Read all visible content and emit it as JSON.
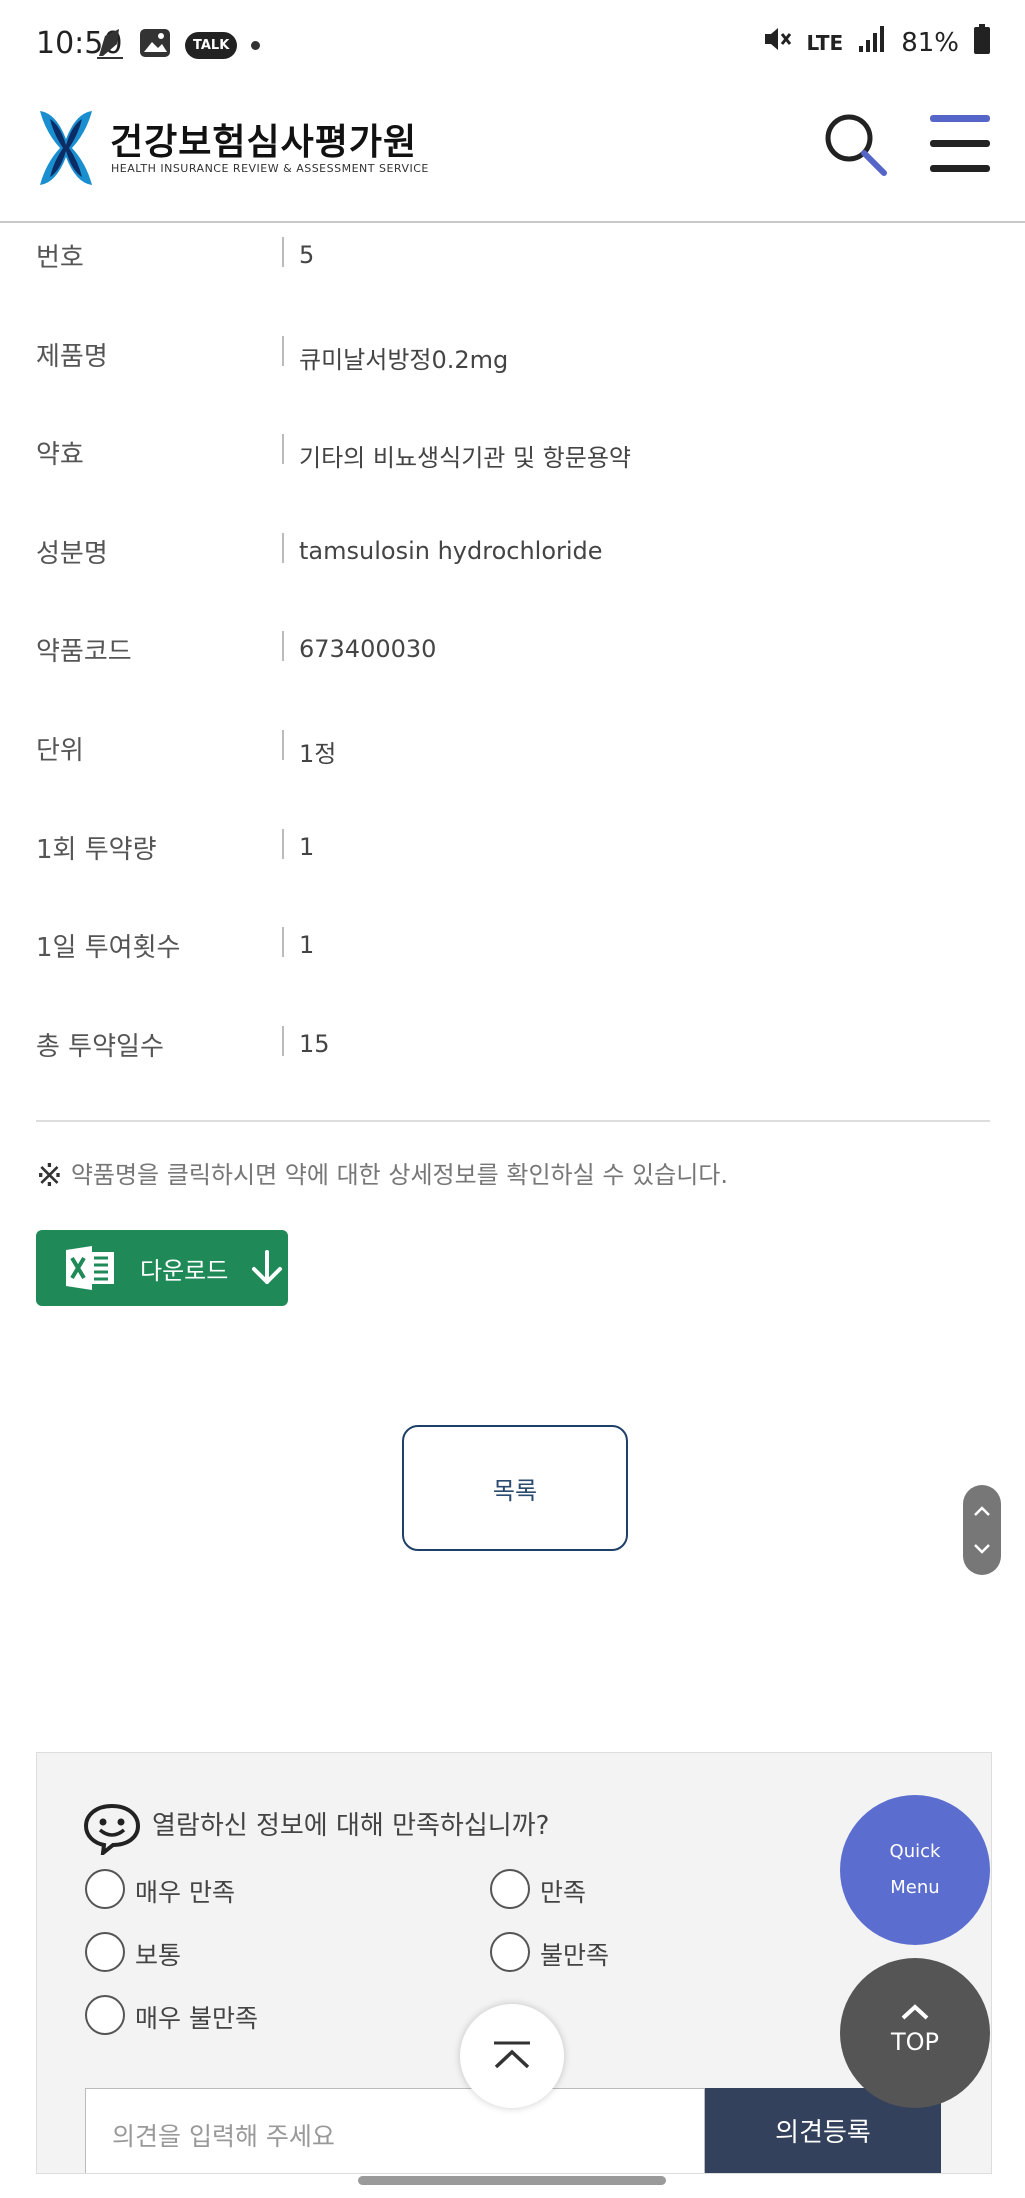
{
  "status_bar": {
    "time": "10:50",
    "talk_label": "TALK",
    "network": "LTE",
    "battery": "81%"
  },
  "header": {
    "brand_ko": "건강보험심사평가원",
    "brand_en": "HEALTH INSURANCE REVIEW & ASSESSMENT SERVICE"
  },
  "details": [
    {
      "label": "번호",
      "value": "5"
    },
    {
      "label": "제품명",
      "value": "큐미날서방정0.2mg"
    },
    {
      "label": "약효",
      "value": "기타의 비뇨생식기관 및 항문용약"
    },
    {
      "label": "성분명",
      "value": "tamsulosin hydrochloride"
    },
    {
      "label": "약품코드",
      "value": "673400030"
    },
    {
      "label": "단위",
      "value": "1정"
    },
    {
      "label": "1회 투약량",
      "value": "1"
    },
    {
      "label": "1일 투여횟수",
      "value": "1"
    },
    {
      "label": "총 투약일수",
      "value": "15"
    }
  ],
  "notice": {
    "mark": "※",
    "text": "약품명을 클릭하시면 약에 대한 상세정보를 확인하실 수 있습니다."
  },
  "download_label": "다운로드",
  "list_button_label": "목록",
  "survey": {
    "question": "열람하신 정보에 대해 만족하십니까?",
    "options": [
      "매우 만족",
      "만족",
      "보통",
      "불만족",
      "매우 불만족"
    ],
    "input_placeholder": "의견을 입력해 주세요",
    "submit_label": "의견등록"
  },
  "quick_menu": {
    "line1": "Quick",
    "line2": "Menu"
  },
  "top_label": "TOP",
  "colors": {
    "excel_green": "#1f8a58",
    "quick_menu_blue": "#5b6ed0",
    "submit_navy": "#33415c",
    "list_border": "#1e3f66"
  }
}
